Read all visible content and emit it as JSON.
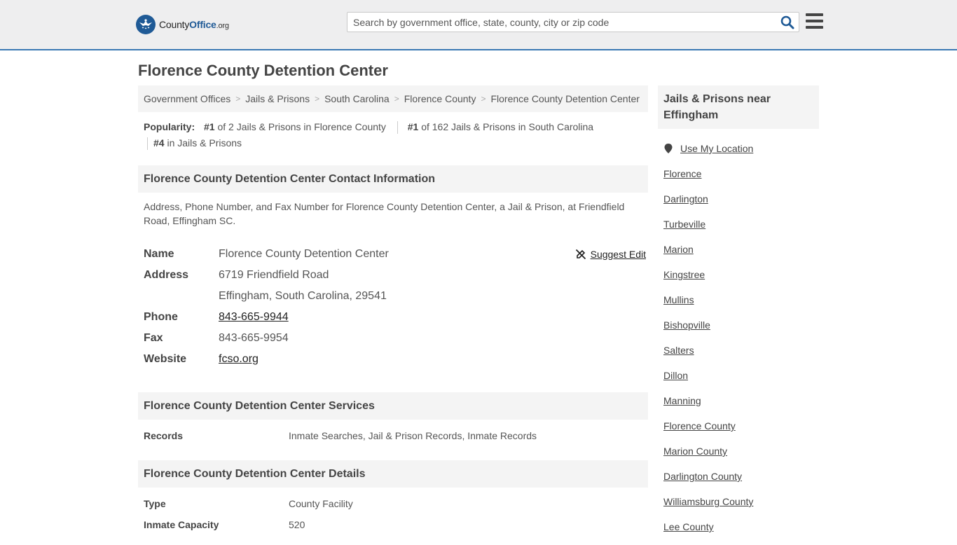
{
  "header": {
    "logo_main": "County",
    "logo_accent": "Office",
    "logo_suffix": ".org",
    "search_placeholder": "Search by government office, state, county, city or zip code"
  },
  "page_title": "Florence County Detention Center",
  "breadcrumb": [
    "Government Offices",
    "Jails & Prisons",
    "South Carolina",
    "Florence County",
    "Florence County Detention Center"
  ],
  "popularity": {
    "label": "Popularity:",
    "items": [
      {
        "rank": "#1",
        "text": "of 2 Jails & Prisons in Florence County"
      },
      {
        "rank": "#1",
        "text": "of 162 Jails & Prisons in South Carolina"
      },
      {
        "rank": "#4",
        "text": "in Jails & Prisons"
      }
    ]
  },
  "contact": {
    "heading": "Florence County Detention Center Contact Information",
    "description": "Address, Phone Number, and Fax Number for Florence County Detention Center, a Jail & Prison, at Friendfield Road, Effingham SC.",
    "suggest_edit": "Suggest Edit",
    "name_label": "Name",
    "name": "Florence County Detention Center",
    "address_label": "Address",
    "address_line1": "6719 Friendfield Road",
    "address_line2": "Effingham, South Carolina, 29541",
    "phone_label": "Phone",
    "phone": "843-665-9944",
    "fax_label": "Fax",
    "fax": "843-665-9954",
    "website_label": "Website",
    "website": "fcso.org"
  },
  "services": {
    "heading": "Florence County Detention Center Services",
    "label": "Records",
    "value": "Inmate Searches, Jail & Prison Records, Inmate Records"
  },
  "details": {
    "heading": "Florence County Detention Center Details",
    "type_label": "Type",
    "type": "County Facility",
    "capacity_label": "Inmate Capacity",
    "capacity": "520"
  },
  "sidebar": {
    "heading": "Jails & Prisons near Effingham",
    "use_location": "Use My Location",
    "links": [
      "Florence",
      "Darlington",
      "Turbeville",
      "Marion",
      "Kingstree",
      "Mullins",
      "Bishopville",
      "Salters",
      "Dillon",
      "Manning",
      "Florence County",
      "Marion County",
      "Darlington County",
      "Williamsburg County",
      "Lee County"
    ]
  },
  "colors": {
    "accent": "#3b78b3",
    "brand": "#1f5a96",
    "panel": "#f4f4f4"
  }
}
